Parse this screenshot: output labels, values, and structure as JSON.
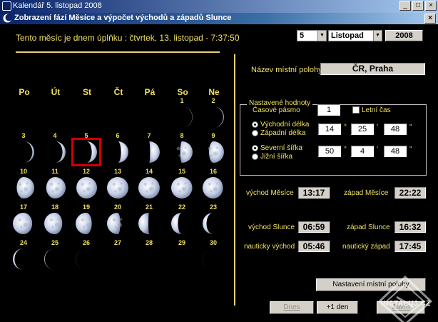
{
  "outer_window": {
    "title": "Kalendář   5. listopad 2008"
  },
  "inner_window": {
    "title": "Zobrazení fází Měsíce a výpočet východů a západů Slunce"
  },
  "full_moon_line": "Tento měsíc je dnem úplňku : čtvrtek,  13. listopad  -   7:37:50",
  "day_select": "5",
  "month_select": "Listopad",
  "year_value": "2008",
  "weekdays": [
    "Po",
    "Út",
    "St",
    "Čt",
    "Pá",
    "So",
    "Ne"
  ],
  "days": [
    {
      "n": "1",
      "phase": 0.08
    },
    {
      "n": "2",
      "phase": 0.13
    },
    {
      "n": "3",
      "phase": 0.19
    },
    {
      "n": "4",
      "phase": 0.25
    },
    {
      "n": "5",
      "phase": 0.33,
      "today": true
    },
    {
      "n": "6",
      "phase": 0.4
    },
    {
      "n": "7",
      "phase": 0.47
    },
    {
      "n": "8",
      "phase": 0.55
    },
    {
      "n": "9",
      "phase": 0.63
    },
    {
      "n": "10",
      "phase": 0.72
    },
    {
      "n": "11",
      "phase": 0.8
    },
    {
      "n": "12",
      "phase": 0.88
    },
    {
      "n": "13",
      "phase": 1.0
    },
    {
      "n": "14",
      "phase": 0.96
    },
    {
      "n": "15",
      "phase": 0.92
    },
    {
      "n": "16",
      "phase": 0.86
    },
    {
      "n": "17",
      "phase": 0.8
    },
    {
      "n": "18",
      "phase": 0.74
    },
    {
      "n": "19",
      "phase": 0.67
    },
    {
      "n": "20",
      "phase": 0.58
    },
    {
      "n": "21",
      "phase": 0.48
    },
    {
      "n": "22",
      "phase": 0.38
    },
    {
      "n": "23",
      "phase": 0.28
    },
    {
      "n": "24",
      "phase": 0.18
    },
    {
      "n": "25",
      "phase": 0.1
    },
    {
      "n": "26",
      "phase": 0.04
    },
    {
      "n": "27",
      "phase": 0.0
    },
    {
      "n": "28",
      "phase": 0.0
    },
    {
      "n": "29",
      "phase": 0.0
    },
    {
      "n": "30",
      "phase": 0.03
    }
  ],
  "location": {
    "label": "Název místní polohy",
    "value": "ČR, Praha"
  },
  "settings": {
    "group_title": "Nastavené hodnoty",
    "timezone_label": "Časové pásmo",
    "timezone_value": "1",
    "dst_label": "Letní čas",
    "east_label": "Východní délka",
    "west_label": "Západní délka",
    "lon_deg": "14",
    "lon_min": "25",
    "lon_sec": "48",
    "north_label": "Severní šířka",
    "south_label": "Jižní šířka",
    "lat_deg": "50",
    "lat_min": "4",
    "lat_sec": "48",
    "deg_sym": "°",
    "min_sym": "'",
    "sec_sym": "\""
  },
  "times": {
    "moonrise_label": "východ Měsíce",
    "moonrise": "13:17",
    "moonset_label": "západ Měsíce",
    "moonset": "22:22",
    "sunrise_label": "východ Slunce",
    "sunrise": "06:59",
    "sunset_label": "západ Slunce",
    "sunset": "16:32",
    "naut_rise_label": "nauticky východ",
    "naut_rise": "05:46",
    "naut_set_label": "nautický západ",
    "naut_set": "17:45"
  },
  "buttons": {
    "set_location": "Nastavení místní polohy",
    "today": "Dnes",
    "plus_day": "+1 den",
    "close": "Zavřít"
  },
  "watermark": "INSTALUJ.CZ",
  "colors": {
    "label": "#f0e060",
    "today_border": "#d00000",
    "background": "#000000"
  }
}
